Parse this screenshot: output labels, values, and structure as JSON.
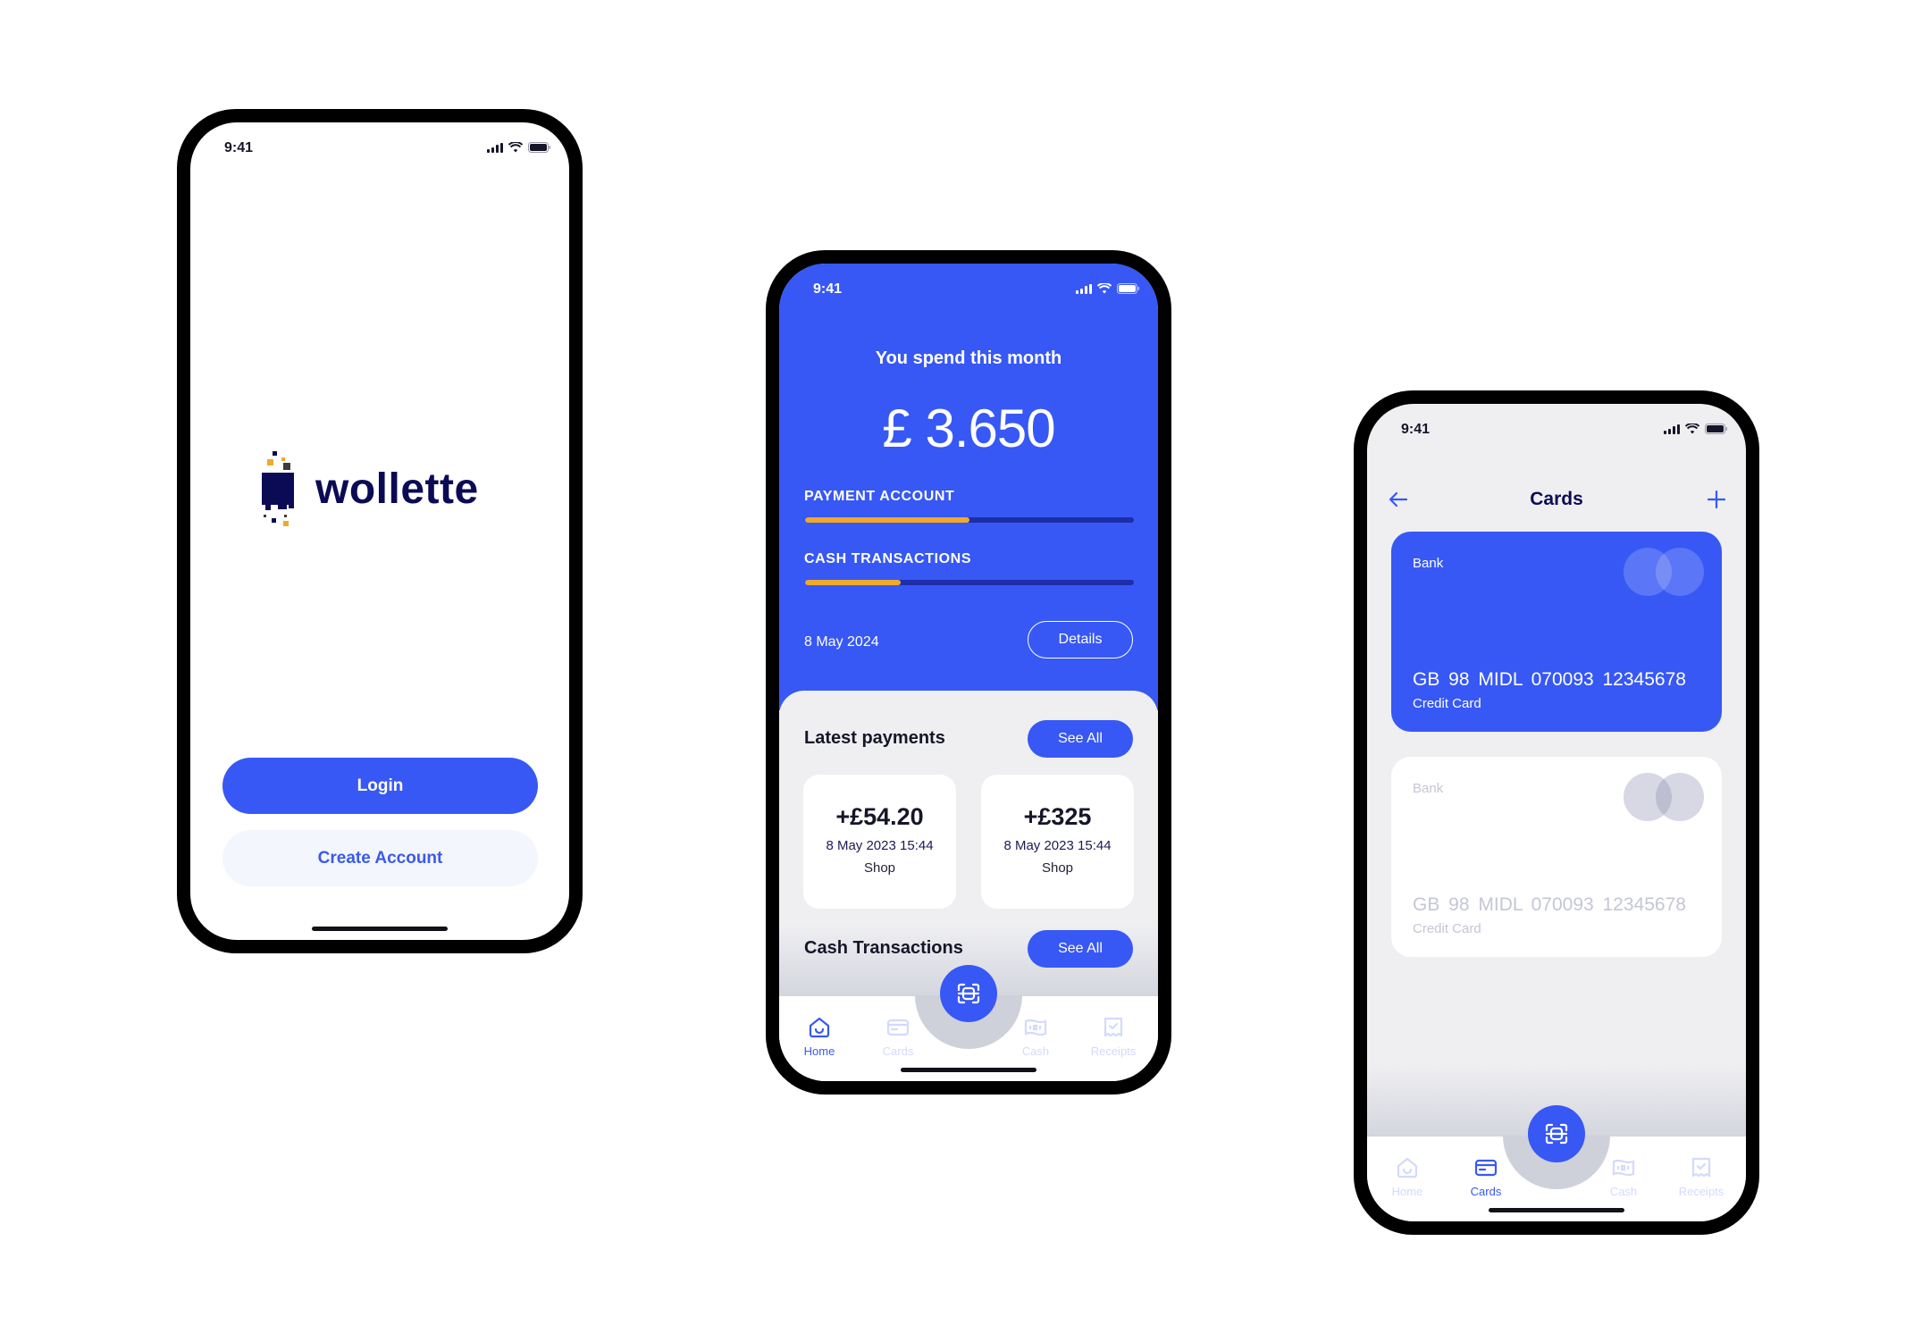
{
  "colors": {
    "primary": "#3758f5",
    "accent": "#f0a92a",
    "navy": "#0b0b55",
    "track": "#1e2ea8",
    "surface": "#efeff2"
  },
  "status_bar": {
    "time": "9:41",
    "icons": [
      "signal-icon",
      "wifi-icon",
      "battery-icon"
    ]
  },
  "login_screen": {
    "logo_text": "wollette",
    "login_button": "Login",
    "create_account_button": "Create Account"
  },
  "home_screen": {
    "spend_label": "You spend this month",
    "spend_amount": "£ 3.650",
    "progress_bars": [
      {
        "label": "PAYMENT ACCOUNT",
        "fill_percent": 50
      },
      {
        "label": "CASH TRANSACTIONS",
        "fill_percent": 29
      }
    ],
    "date": "8 May 2024",
    "details_button": "Details",
    "latest_payments": {
      "title": "Latest payments",
      "see_all": "See All",
      "items": [
        {
          "amount": "+£54.20",
          "datetime": "8 May 2023 15:44",
          "place": "Shop"
        },
        {
          "amount": "+£325",
          "datetime": "8 May 2023 15:44",
          "place": "Shop"
        }
      ]
    },
    "cash_transactions": {
      "title": "Cash Transactions",
      "see_all": "See All"
    }
  },
  "cards_screen": {
    "title": "Cards",
    "back_icon": "arrow-left-icon",
    "add_icon": "plus-icon",
    "cards": [
      {
        "bank": "Bank",
        "number": "GB 98 MIDL 070093 12345678",
        "type": "Credit Card",
        "active": true
      },
      {
        "bank": "Bank",
        "number": "GB 98 MIDL 070093 12345678",
        "type": "Credit Card",
        "active": false
      }
    ]
  },
  "tab_bar": {
    "tabs": [
      {
        "label": "Home",
        "icon": "home-icon"
      },
      {
        "label": "Cards",
        "icon": "card-icon"
      },
      {
        "label": "Cash",
        "icon": "cash-icon"
      },
      {
        "label": "Receipts",
        "icon": "receipt-icon"
      }
    ],
    "scan_icon": "scan-icon",
    "home_active": "Home",
    "cards_active": "Cards"
  }
}
